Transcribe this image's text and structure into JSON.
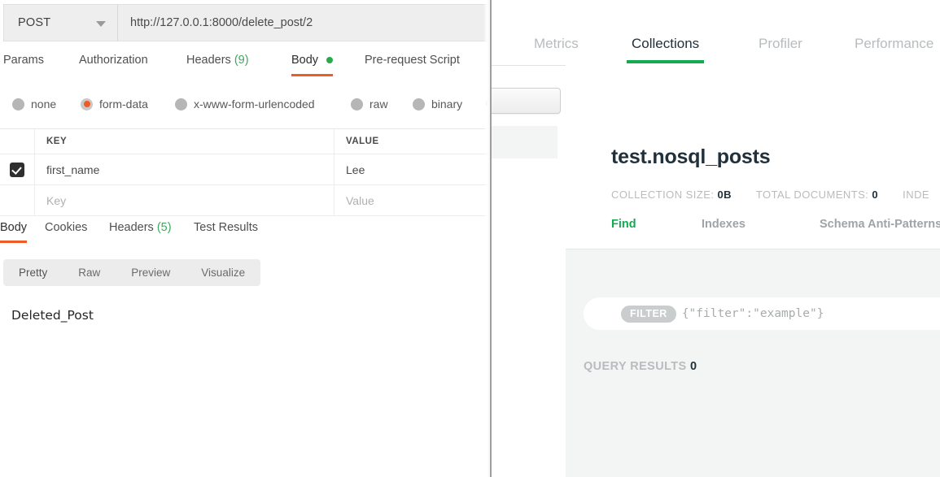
{
  "postman": {
    "request": {
      "method": "POST",
      "url": "http://127.0.0.1:8000/delete_post/2",
      "tabs": [
        {
          "label": "Params",
          "count": "",
          "active": false,
          "dot": false
        },
        {
          "label": "Authorization",
          "count": "",
          "active": false,
          "dot": false
        },
        {
          "label": "Headers",
          "count": "(9)",
          "active": false,
          "dot": false
        },
        {
          "label": "Body",
          "count": "",
          "active": true,
          "dot": true
        },
        {
          "label": "Pre-request Script",
          "count": "",
          "active": false,
          "dot": false
        }
      ],
      "body_types": [
        {
          "label": "none",
          "selected": false
        },
        {
          "label": "form-data",
          "selected": true
        },
        {
          "label": "x-www-form-urlencoded",
          "selected": false
        },
        {
          "label": "raw",
          "selected": false
        },
        {
          "label": "binary",
          "selected": false
        }
      ],
      "table": {
        "headers": {
          "key": "KEY",
          "value": "VALUE"
        },
        "rows": [
          {
            "checked": true,
            "key": "first_name",
            "value": "Lee"
          }
        ],
        "placeholder_row": {
          "key": "Key",
          "value": "Value"
        }
      }
    },
    "response": {
      "tabs": [
        {
          "label": "Body",
          "count": "",
          "active": true
        },
        {
          "label": "Cookies",
          "count": "",
          "active": false
        },
        {
          "label": "Headers",
          "count": "(5)",
          "active": false
        },
        {
          "label": "Test Results",
          "count": "",
          "active": false
        }
      ],
      "view_modes": [
        {
          "label": "Pretty",
          "active": true
        },
        {
          "label": "Raw",
          "active": false
        },
        {
          "label": "Preview",
          "active": false
        },
        {
          "label": "Visualize",
          "active": false
        }
      ],
      "body_text": "Deleted_Post"
    }
  },
  "compass": {
    "tabs": [
      {
        "label": "Metrics",
        "active": false
      },
      {
        "label": "Collections",
        "active": true
      },
      {
        "label": "Profiler",
        "active": false
      },
      {
        "label": "Performance",
        "active": false
      }
    ],
    "collection": {
      "title": "test.nosql_posts",
      "stats": {
        "collection_size_label": "COLLECTION SIZE:",
        "collection_size_value": "0B",
        "total_documents_label": "TOTAL DOCUMENTS:",
        "total_documents_value": "0",
        "indexes_label": "INDE"
      },
      "subtabs": [
        {
          "label": "Find",
          "active": true
        },
        {
          "label": "Indexes",
          "active": false
        },
        {
          "label": "Schema Anti-Patterns (",
          "active": false
        }
      ]
    },
    "query": {
      "filter_pill": "FILTER",
      "filter_placeholder": "{\"filter\":\"example\"}",
      "results_label": "QUERY RESULTS",
      "results_count": "0"
    }
  },
  "colors": {
    "postman_accent": "#EF5B25",
    "postman_green": "#3ea75e",
    "compass_green": "#13aa52",
    "compass_dark": "#21313c"
  }
}
